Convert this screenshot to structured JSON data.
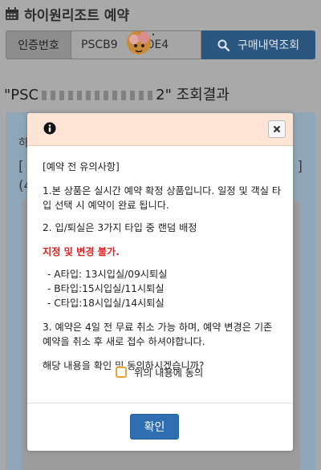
{
  "header": {
    "title": "하이원리조트 예약",
    "icon": "calendar-icon"
  },
  "search": {
    "label": "인증번호",
    "value": "PSCB9",
    "value_suffix": "40E4",
    "button_label": "구매내역조회",
    "button_icon": "search-icon"
  },
  "result": {
    "title_prefix": "\"PSC",
    "title_suffix": "2\" 조회결과",
    "fragments": [
      "하",
      "[",
      "(4",
      "]"
    ]
  },
  "modal": {
    "header_icon": "info-icon",
    "close_icon": "close-icon",
    "notice_title": "[예약 전 유의사항]",
    "item1": "1.본 상품은 실시간 예약 확정 상품입니다. 일정 및 객실 타입 선택 시 예약이 완료 됩니다.",
    "item2": "2. 입/퇴실은 3가지 타입 중 랜덤 배정",
    "warning": "지정 및 변경 불가.",
    "types": [
      "- A타입: 13시입실/09시퇴실",
      "- B타입:15시입실/11시퇴실",
      "- C타입:18시입실/14시퇴실"
    ],
    "item3": "3. 예약은 4일 전 무료 취소 가능 하며, 예약 변경은 기존 예약을 취소 후 새로 접수 하셔야합니다.",
    "question": "해당 내용을 확인 및 동의하시겠습니까?",
    "agree_label": "위의 내용에 동의",
    "agree_checked": false,
    "confirm_label": "확인"
  },
  "colors": {
    "search_button": "#2a5680",
    "modal_header": "#fde4d4",
    "warning_text": "#e02222",
    "confirm_button": "#2f6fb1",
    "checkbox_border": "#e8a33a"
  }
}
